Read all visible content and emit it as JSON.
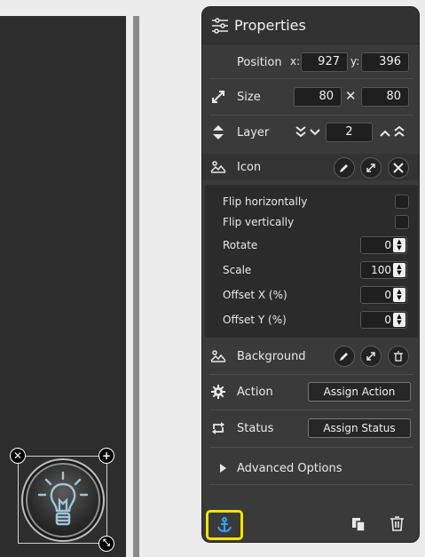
{
  "panel": {
    "title": "Properties",
    "position": {
      "label": "Position",
      "x_label": "x:",
      "x": "927",
      "y_label": "y:",
      "y": "396"
    },
    "size": {
      "label": "Size",
      "width": "80",
      "times": "✕",
      "height": "80"
    },
    "layer": {
      "label": "Layer",
      "value": "2"
    },
    "icon": {
      "label": "Icon"
    },
    "icon_options": {
      "flip_h": "Flip horizontally",
      "flip_v": "Flip vertically",
      "rotate": {
        "label": "Rotate",
        "value": "0"
      },
      "scale": {
        "label": "Scale",
        "value": "100"
      },
      "offset_x": {
        "label": "Offset X (%)",
        "value": "0"
      },
      "offset_y": {
        "label": "Offset Y (%)",
        "value": "0"
      }
    },
    "background": {
      "label": "Background"
    },
    "action": {
      "label": "Action",
      "button": "Assign Action"
    },
    "status": {
      "label": "Status",
      "button": "Assign Status"
    },
    "advanced": {
      "label": "Advanced Options"
    }
  },
  "icons": {
    "settings_sliders": "sliders-icon",
    "expand": "expand-arrows-icon",
    "layer": "up-down-icon",
    "image": "image-icon",
    "gear": "gear-icon",
    "repeat": "repeat-icon",
    "anchor": "anchor-icon",
    "copy": "copy-icon",
    "trash": "trash-icon",
    "bulb": "lightbulb-icon"
  },
  "colors": {
    "highlight": "#f5e400",
    "anchor": "#3aa0ff",
    "panel_bg": "#3a3a3a",
    "canvas_bg": "#2d2d2d"
  }
}
